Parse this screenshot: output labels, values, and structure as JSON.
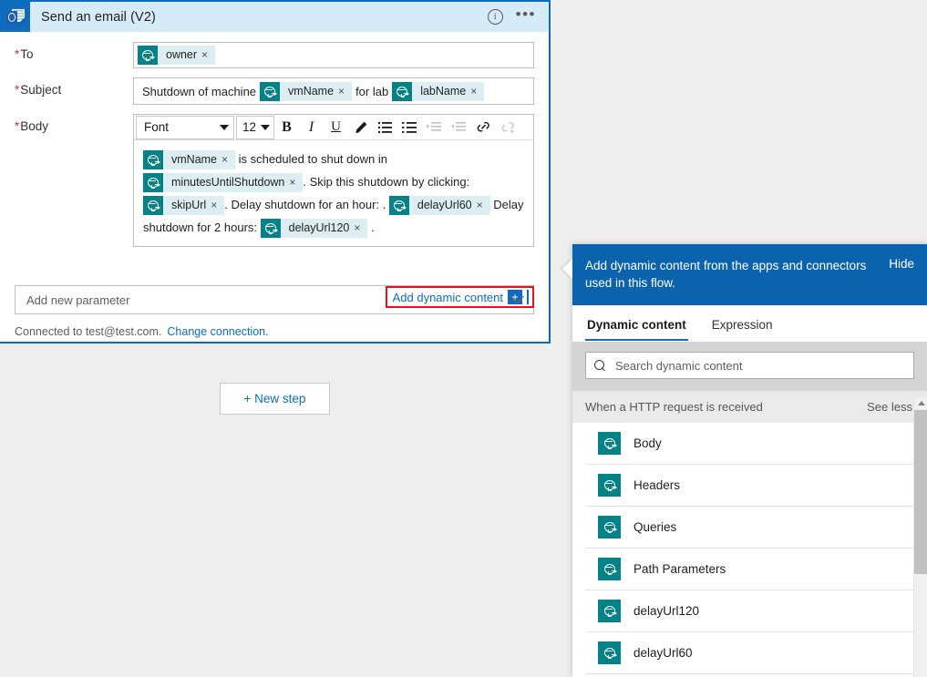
{
  "card": {
    "app_icon": "outlook-icon",
    "title": "Send an email (V2)",
    "info_icon": "i",
    "ellipsis_icon": "•••",
    "fields": {
      "to": {
        "label": "To",
        "required": true,
        "tokens": [
          {
            "label": "owner",
            "remove": "×"
          }
        ]
      },
      "subject": {
        "label": "Subject",
        "required": true,
        "parts": [
          {
            "type": "text",
            "value": "Shutdown of machine"
          },
          {
            "type": "token",
            "value": "vmName",
            "remove": "×"
          },
          {
            "type": "text",
            "value": "for lab"
          },
          {
            "type": "token",
            "value": "labName",
            "remove": "×"
          }
        ]
      },
      "body": {
        "label": "Body",
        "required": true,
        "toolbar": {
          "font_name": "Font",
          "font_size": "12",
          "bold": "B",
          "italic": "I",
          "underline": "U",
          "highlight_icon": "pen-icon",
          "numbered_list_icon": "numbered-list-icon",
          "bulleted_list_icon": "bulleted-list-icon",
          "indent_icon": "indent-icon",
          "outdent_icon": "outdent-icon",
          "link_icon": "link-icon",
          "unlink_icon": "unlink-icon"
        },
        "content": [
          {
            "type": "token",
            "value": "vmName",
            "remove": "×"
          },
          {
            "type": "text",
            "value": " is scheduled to shut down in "
          },
          {
            "type": "token",
            "value": "minutesUntilShutdown",
            "remove": "×"
          },
          {
            "type": "text",
            "value": ". Skip this shutdown by clicking: "
          },
          {
            "type": "token",
            "value": "skipUrl",
            "remove": "×"
          },
          {
            "type": "text",
            "value": ". Delay shutdown for an hour: . "
          },
          {
            "type": "token",
            "value": "delayUrl60",
            "remove": "×"
          },
          {
            "type": "text",
            "value": " Delay shutdown for 2 hours: "
          },
          {
            "type": "token",
            "value": "delayUrl120",
            "remove": "×"
          },
          {
            "type": "text",
            "value": " ."
          }
        ]
      }
    },
    "add_dynamic_content": {
      "label": "Add dynamic content",
      "plus": "+",
      "highlight_color": "#e81123"
    },
    "add_new_parameter": "Add new parameter",
    "connection": {
      "text": "Connected to test@test.com.",
      "change_link": "Change connection."
    }
  },
  "canvas": {
    "new_step_button": "+ New step"
  },
  "panel": {
    "header_text": "Add dynamic content from the apps and connectors used in this flow.",
    "hide_label": "Hide",
    "tabs": [
      {
        "label": "Dynamic content",
        "active": true
      },
      {
        "label": "Expression",
        "active": false
      }
    ],
    "search": {
      "placeholder": "Search dynamic content",
      "icon": "search-icon"
    },
    "group": {
      "title": "When a HTTP request is received",
      "toggle_label": "See less"
    },
    "items": [
      {
        "label": "Body"
      },
      {
        "label": "Headers"
      },
      {
        "label": "Queries"
      },
      {
        "label": "Path Parameters"
      },
      {
        "label": "delayUrl120"
      },
      {
        "label": "delayUrl60"
      }
    ]
  },
  "colors": {
    "accent_blue": "#0f6cbd",
    "panel_header_blue": "#0b63ad",
    "token_teal": "#038387",
    "token_bg": "#dceef1",
    "highlight_red": "#e81123",
    "card_border": "#0b6cbd"
  }
}
